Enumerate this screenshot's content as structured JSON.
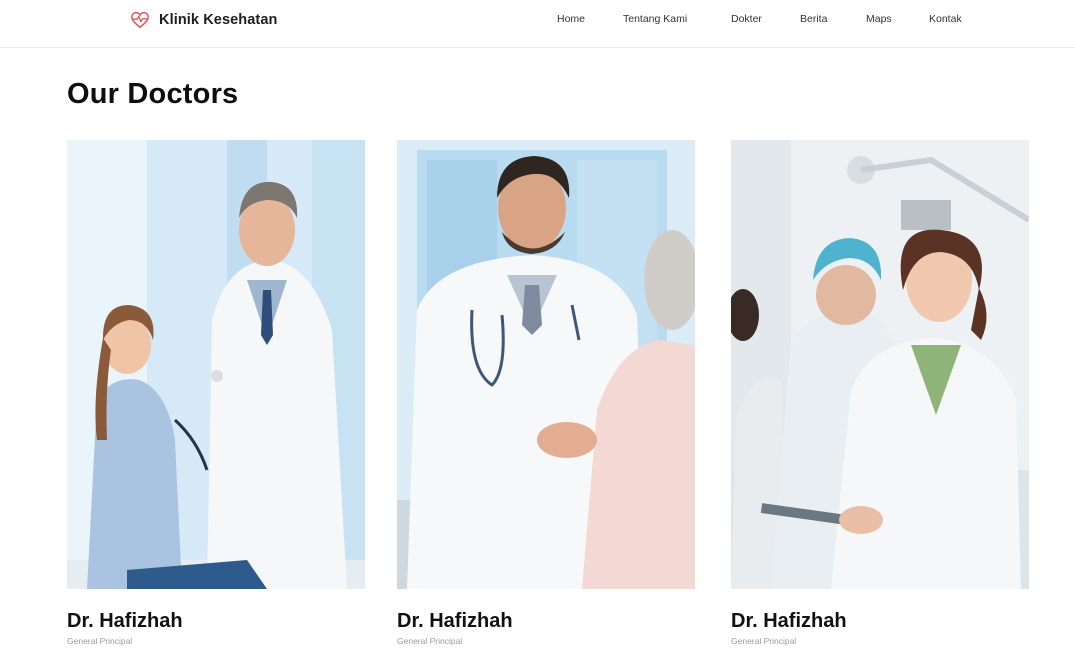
{
  "navbar": {
    "brand": {
      "name": "Klinik Kesehatan",
      "icon": "heart-pulse-icon"
    },
    "links": [
      "Home",
      "Tentang Kami",
      "Dokter",
      "Berita",
      "Maps",
      "Kontak"
    ]
  },
  "page_title": "Our Doctors",
  "doctors": [
    {
      "name": "Dr. Hafizhah",
      "role": "General Principal"
    },
    {
      "name": "Dr. Hafizhah",
      "role": "General Principal"
    },
    {
      "name": "Dr. Hafizhah",
      "role": "General Principal"
    }
  ],
  "colors": {
    "brand_accent": "#e0525c",
    "text": "#111111",
    "muted": "#9a9a9a"
  }
}
